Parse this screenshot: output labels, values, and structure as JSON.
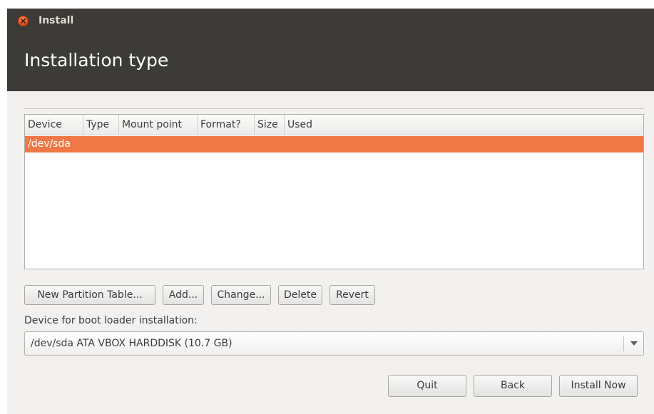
{
  "window": {
    "title": "Install"
  },
  "header": {
    "title": "Installation type"
  },
  "partition_table": {
    "columns": [
      "Device",
      "Type",
      "Mount point",
      "Format?",
      "Size",
      "Used"
    ],
    "rows": [
      {
        "device": "/dev/sda",
        "selected": true
      }
    ]
  },
  "partition_actions": {
    "new_partition_table": "New Partition Table...",
    "add": "Add...",
    "change": "Change...",
    "delete": "Delete",
    "revert": "Revert"
  },
  "boot_loader": {
    "label": "Device for boot loader installation:",
    "selected": "/dev/sda  ATA VBOX HARDDISK (10.7 GB)"
  },
  "footer": {
    "quit": "Quit",
    "back": "Back",
    "install_now": "Install Now"
  },
  "colors": {
    "header_bg": "#3c3b37",
    "selection": "#f07846",
    "close_button": "#dd4814"
  }
}
